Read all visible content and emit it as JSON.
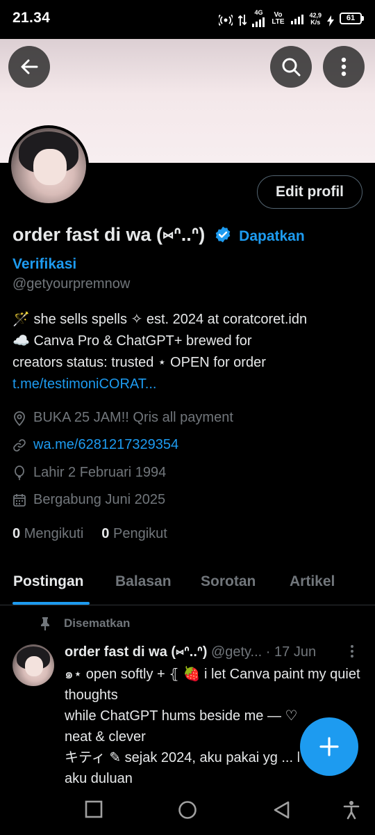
{
  "status_bar": {
    "time": "21.34",
    "net_4g": "4G",
    "vo_lte": "Vo LTE",
    "speed": "42,9",
    "speed_unit": "K/s",
    "battery": "61"
  },
  "profile": {
    "display_name": "order fast di wa (⑅ᐢ..ᐢ)",
    "get_verified_label_1": "Dapatkan",
    "get_verified_label_2": "Verifikasi",
    "handle": "@getyourpremnow",
    "edit_button": "Edit profil",
    "bio_line1": "🪄 she sells spells ✧ est. 2024 at coratcoret.idn",
    "bio_line2": "☁️ Canva Pro & ChatGPT+ brewed for",
    "bio_line3_text": "creators   status: trusted ⋆ OPEN for order ",
    "bio_link": "t.me/testimoniCORAT...",
    "location": "BUKA 25 JAM!! Qris all payment",
    "website": "wa.me/6281217329354",
    "birth": "Lahir 2 Februari 1994",
    "joined": "Bergabung Juni 2025",
    "following_count": "0",
    "following_label": "Mengikuti",
    "followers_count": "0",
    "followers_label": "Pengikut"
  },
  "tabs": [
    {
      "label": "Postingan",
      "active": true
    },
    {
      "label": "Balasan",
      "active": false
    },
    {
      "label": "Sorotan",
      "active": false
    },
    {
      "label": "Artikel",
      "active": false
    }
  ],
  "pinned_post": {
    "pinned_label": "Disematkan",
    "author": "order fast di wa (⑅ᐢ..ᐢ)",
    "handle": "@gety...",
    "date": "· 17 Jun",
    "text": "๑⋆ open softly + ⦃ 🍓 i let Canva paint my quiet thoughts\nwhile ChatGPT hums beside me — ♡\nneat & clever\nキティ ✎ sejak 2024, aku pakai yg ... l\naku duluan"
  },
  "colors": {
    "accent": "#1d9bf0",
    "background": "#000000",
    "text_primary": "#e7e9ea",
    "text_secondary": "#71767b",
    "banner": "#f4e8ea"
  },
  "icons": [
    "back-arrow-icon",
    "search-icon",
    "more-vertical-icon",
    "verified-badge-icon",
    "location-icon",
    "link-icon",
    "birthday-icon",
    "calendar-icon",
    "pin-icon",
    "compose-plus-icon",
    "recent-apps-icon",
    "home-icon",
    "back-triangle-icon",
    "accessibility-icon"
  ]
}
